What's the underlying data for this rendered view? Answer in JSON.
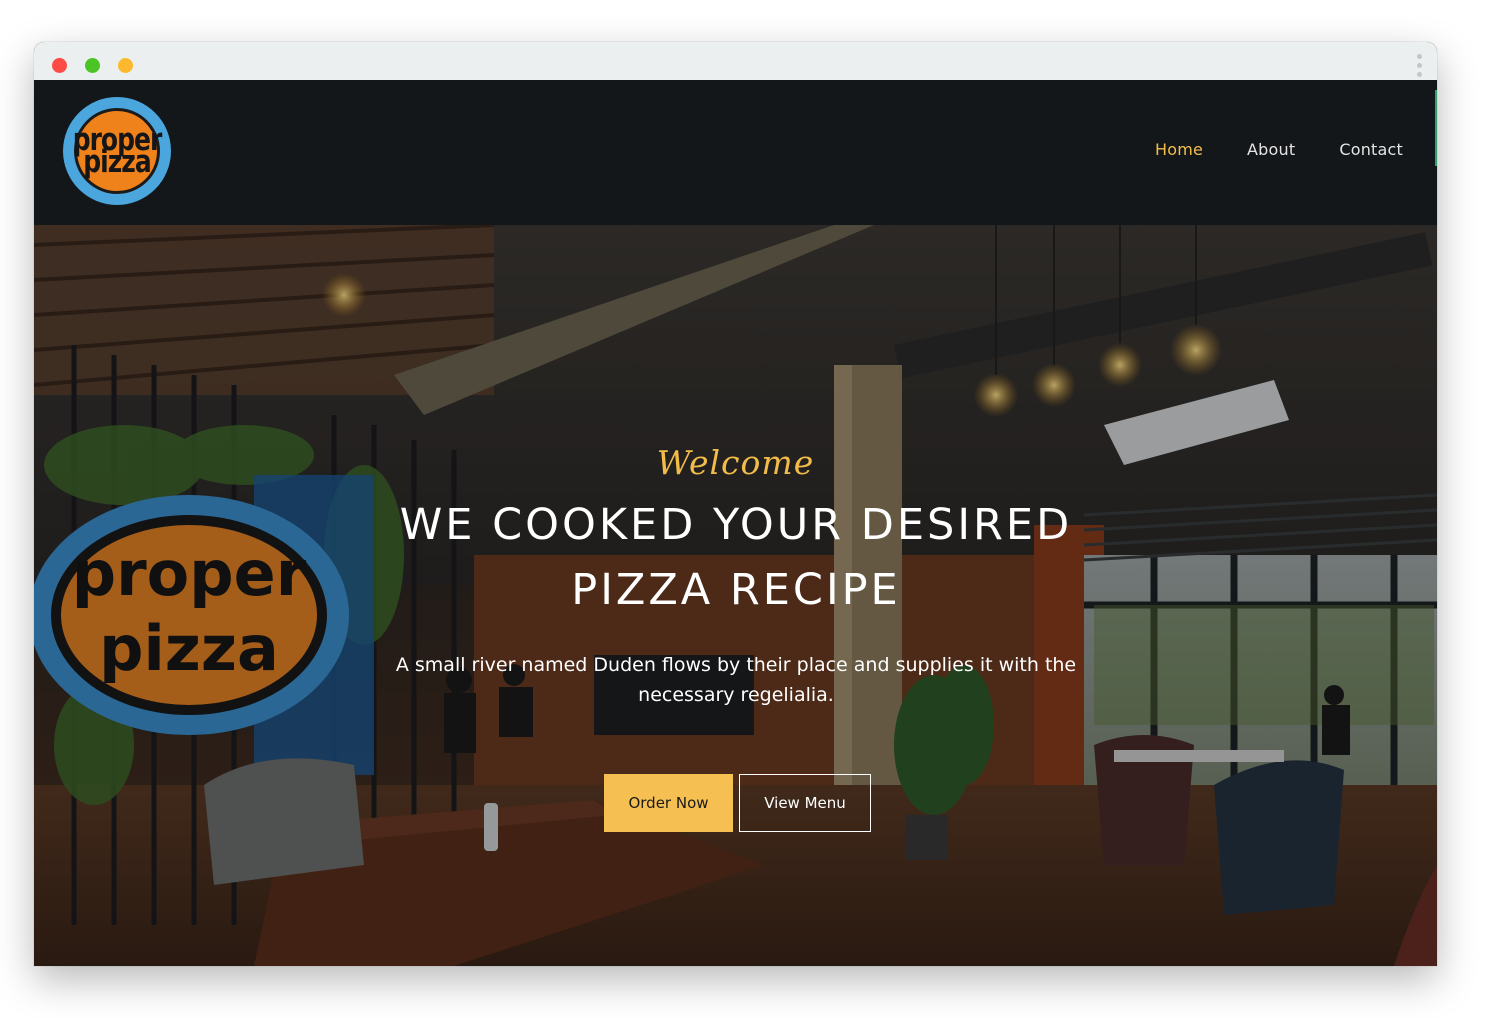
{
  "browser": {
    "controls": [
      "close",
      "minimize",
      "maximize"
    ]
  },
  "brand": {
    "logo_line1": "proper",
    "logo_line2": "pizza"
  },
  "nav": {
    "items": [
      {
        "label": "Home",
        "active": true
      },
      {
        "label": "About",
        "active": false
      },
      {
        "label": "Contact",
        "active": false
      }
    ]
  },
  "hero": {
    "kicker": "Welcome",
    "title": "WE COOKED YOUR DESIRED PIZZA RECIPE",
    "subtitle": "A small river named Duden flows by their place and supplies it with the necessary regelialia.",
    "buttons": {
      "primary": "Order Now",
      "secondary": "View Menu"
    },
    "sign_text_line1": "proper",
    "sign_text_line2": "pizza"
  },
  "colors": {
    "accent": "#f5bf52",
    "nav_bg": "#13171a",
    "logo_ring": "#4aa6dd",
    "logo_fill": "#f0821c"
  }
}
